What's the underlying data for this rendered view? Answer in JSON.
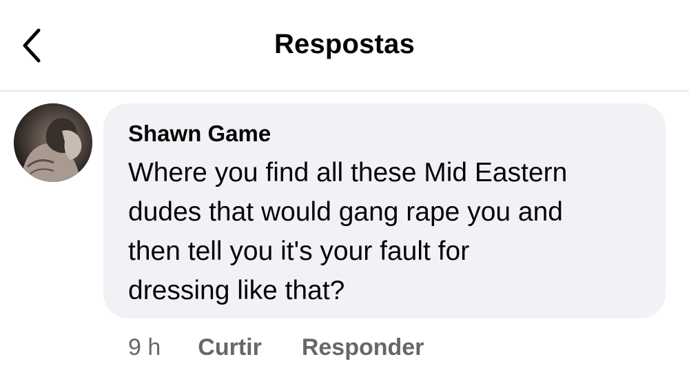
{
  "header": {
    "title": "Respostas",
    "back_icon": "chevron-left-icon"
  },
  "comment": {
    "author": "Shawn Game",
    "text": "Where you find all these Mid Eastern\ndudes that would gang rape you and\nthen tell you it's your fault for\ndressing like that?",
    "time": "9 h",
    "like_label": "Curtir",
    "reply_label": "Responder"
  },
  "colors": {
    "bubble": "#f0f2f5",
    "divider": "#e4e6eb",
    "meta_text": "#65676b",
    "text": "#050505"
  }
}
